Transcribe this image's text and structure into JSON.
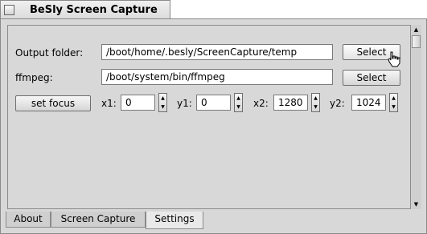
{
  "window": {
    "title": "BeSly Screen Capture"
  },
  "settings": {
    "output_folder_label": "Output folder:",
    "output_folder_value": "/boot/home/.besly/ScreenCapture/temp",
    "output_select_label": "Select",
    "ffmpeg_label": "ffmpeg:",
    "ffmpeg_value": "/boot/system/bin/ffmpeg",
    "ffmpeg_select_label": "Select",
    "set_focus_label": "set focus",
    "x1_label": "x1:",
    "x1_value": "0",
    "y1_label": "y1:",
    "y1_value": "0",
    "x2_label": "x2:",
    "x2_value": "1280",
    "y2_label": "y2:",
    "y2_value": "1024"
  },
  "tabs": [
    {
      "label": "About"
    },
    {
      "label": "Screen Capture"
    },
    {
      "label": "Settings",
      "active": true
    }
  ]
}
